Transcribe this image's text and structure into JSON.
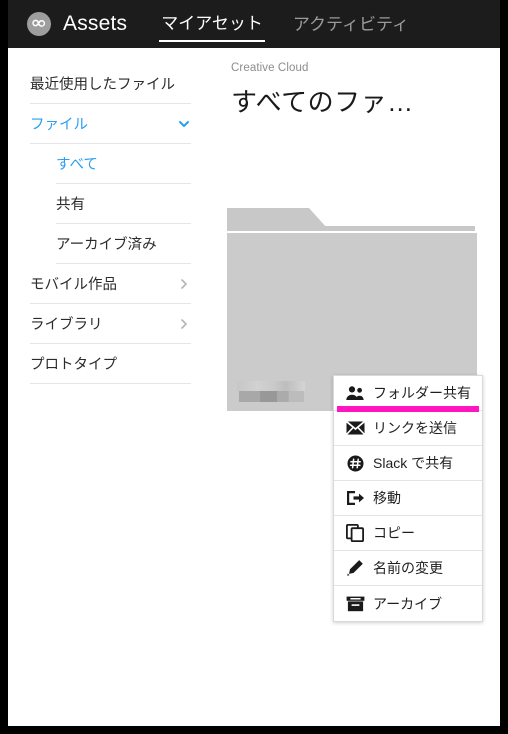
{
  "app": {
    "logo_icon": "creative-cloud-logo",
    "brand_name": "Assets"
  },
  "tabs": [
    {
      "label": "マイアセット",
      "active": true
    },
    {
      "label": "アクティビティ",
      "active": false
    }
  ],
  "sidebar": {
    "items": [
      {
        "label": "最近使用したファイル",
        "active": false,
        "sub": false,
        "chevron": "none"
      },
      {
        "label": "ファイル",
        "active": true,
        "sub": false,
        "chevron": "chevron-down-icon"
      },
      {
        "label": "すべて",
        "active": true,
        "sub": true,
        "chevron": "none"
      },
      {
        "label": "共有",
        "active": false,
        "sub": true,
        "chevron": "none"
      },
      {
        "label": "アーカイブ済み",
        "active": false,
        "sub": true,
        "chevron": "none"
      },
      {
        "label": "モバイル作品",
        "active": false,
        "sub": false,
        "chevron": "chevron-right-icon"
      },
      {
        "label": "ライブラリ",
        "active": false,
        "sub": false,
        "chevron": "chevron-right-icon"
      },
      {
        "label": "プロトタイプ",
        "active": false,
        "sub": false,
        "chevron": "none"
      }
    ]
  },
  "main": {
    "breadcrumb": "Creative Cloud",
    "title": "すべてのファ…",
    "folder": {
      "name_redacted": true,
      "caret_icon": "caret-down-icon"
    }
  },
  "context_menu": {
    "highlight_color": "#ff16c0",
    "items": [
      {
        "label": "フォルダー共有",
        "icon": "people-share-icon",
        "highlighted": true
      },
      {
        "label": "リンクを送信",
        "icon": "envelope-icon",
        "highlighted": false
      },
      {
        "label": "Slack で共有",
        "icon": "slack-icon",
        "highlighted": false
      },
      {
        "label": "移動",
        "icon": "move-out-icon",
        "highlighted": false
      },
      {
        "label": "コピー",
        "icon": "copy-icon",
        "highlighted": false
      },
      {
        "label": "名前の変更",
        "icon": "pencil-icon",
        "highlighted": false
      },
      {
        "label": "アーカイブ",
        "icon": "archive-box-icon",
        "highlighted": false
      }
    ]
  },
  "colors": {
    "topbar_bg": "#1c1c1c",
    "accent_blue": "#2a9ff0",
    "highlight_magenta": "#ff16c0",
    "folder_gray": "#cbcbcb"
  }
}
